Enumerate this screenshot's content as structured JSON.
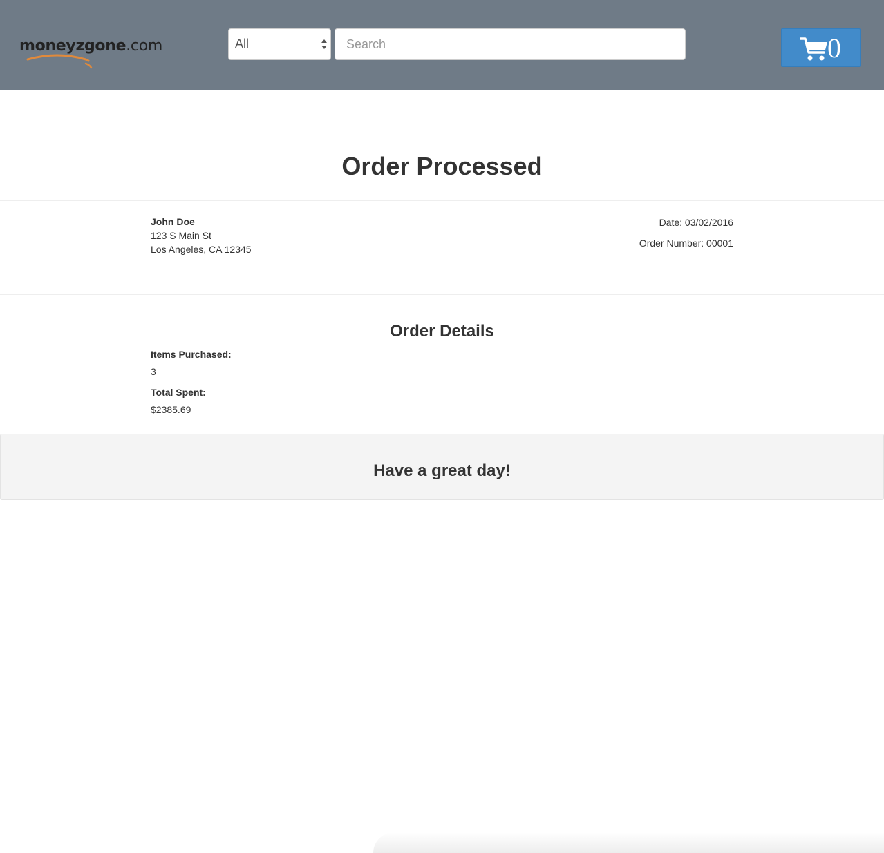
{
  "header": {
    "logo": {
      "brand": "moneyzgone",
      "tld": ".com"
    },
    "category_select": {
      "selected": "All"
    },
    "search": {
      "placeholder": "Search"
    },
    "cart": {
      "count": "0",
      "icon": "shopping-cart-icon"
    }
  },
  "colors": {
    "navbar": "#6f7b87",
    "cart_button": "#428bca",
    "logo_swoosh": "#e08a3c"
  },
  "main": {
    "title": "Order Processed",
    "customer": {
      "name": "John Doe",
      "address_line1": "123 S Main St",
      "address_line2": "Los Angeles, CA 12345"
    },
    "order": {
      "date": "Date: 03/02/2016",
      "number": "Order Number: 00001"
    },
    "details": {
      "heading": "Order Details",
      "items_label": "Items Purchased:",
      "items_value": "3",
      "total_label": "Total Spent:",
      "total_value": "$2385.69"
    }
  },
  "footer": {
    "message": "Have a great day!"
  }
}
